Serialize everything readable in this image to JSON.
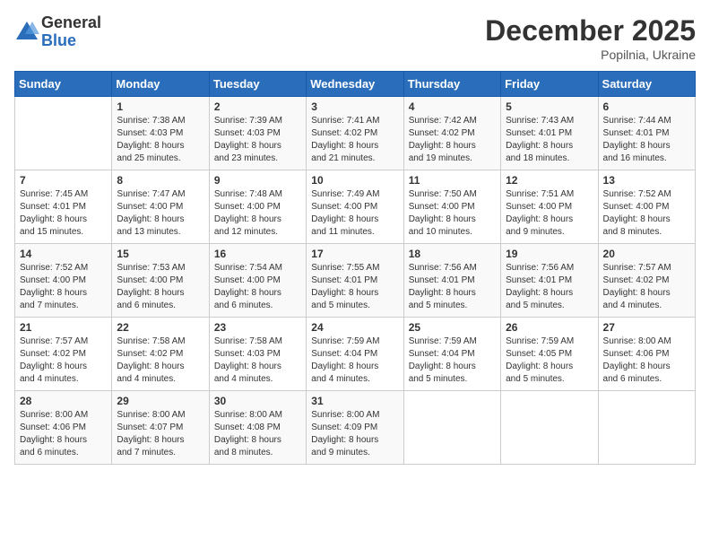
{
  "header": {
    "logo_general": "General",
    "logo_blue": "Blue",
    "month_year": "December 2025",
    "location": "Popilnia, Ukraine"
  },
  "days_of_week": [
    "Sunday",
    "Monday",
    "Tuesday",
    "Wednesday",
    "Thursday",
    "Friday",
    "Saturday"
  ],
  "weeks": [
    [
      {
        "day": "",
        "data": ""
      },
      {
        "day": "1",
        "data": "Sunrise: 7:38 AM\nSunset: 4:03 PM\nDaylight: 8 hours\nand 25 minutes."
      },
      {
        "day": "2",
        "data": "Sunrise: 7:39 AM\nSunset: 4:03 PM\nDaylight: 8 hours\nand 23 minutes."
      },
      {
        "day": "3",
        "data": "Sunrise: 7:41 AM\nSunset: 4:02 PM\nDaylight: 8 hours\nand 21 minutes."
      },
      {
        "day": "4",
        "data": "Sunrise: 7:42 AM\nSunset: 4:02 PM\nDaylight: 8 hours\nand 19 minutes."
      },
      {
        "day": "5",
        "data": "Sunrise: 7:43 AM\nSunset: 4:01 PM\nDaylight: 8 hours\nand 18 minutes."
      },
      {
        "day": "6",
        "data": "Sunrise: 7:44 AM\nSunset: 4:01 PM\nDaylight: 8 hours\nand 16 minutes."
      }
    ],
    [
      {
        "day": "7",
        "data": "Sunrise: 7:45 AM\nSunset: 4:01 PM\nDaylight: 8 hours\nand 15 minutes."
      },
      {
        "day": "8",
        "data": "Sunrise: 7:47 AM\nSunset: 4:00 PM\nDaylight: 8 hours\nand 13 minutes."
      },
      {
        "day": "9",
        "data": "Sunrise: 7:48 AM\nSunset: 4:00 PM\nDaylight: 8 hours\nand 12 minutes."
      },
      {
        "day": "10",
        "data": "Sunrise: 7:49 AM\nSunset: 4:00 PM\nDaylight: 8 hours\nand 11 minutes."
      },
      {
        "day": "11",
        "data": "Sunrise: 7:50 AM\nSunset: 4:00 PM\nDaylight: 8 hours\nand 10 minutes."
      },
      {
        "day": "12",
        "data": "Sunrise: 7:51 AM\nSunset: 4:00 PM\nDaylight: 8 hours\nand 9 minutes."
      },
      {
        "day": "13",
        "data": "Sunrise: 7:52 AM\nSunset: 4:00 PM\nDaylight: 8 hours\nand 8 minutes."
      }
    ],
    [
      {
        "day": "14",
        "data": "Sunrise: 7:52 AM\nSunset: 4:00 PM\nDaylight: 8 hours\nand 7 minutes."
      },
      {
        "day": "15",
        "data": "Sunrise: 7:53 AM\nSunset: 4:00 PM\nDaylight: 8 hours\nand 6 minutes."
      },
      {
        "day": "16",
        "data": "Sunrise: 7:54 AM\nSunset: 4:00 PM\nDaylight: 8 hours\nand 6 minutes."
      },
      {
        "day": "17",
        "data": "Sunrise: 7:55 AM\nSunset: 4:01 PM\nDaylight: 8 hours\nand 5 minutes."
      },
      {
        "day": "18",
        "data": "Sunrise: 7:56 AM\nSunset: 4:01 PM\nDaylight: 8 hours\nand 5 minutes."
      },
      {
        "day": "19",
        "data": "Sunrise: 7:56 AM\nSunset: 4:01 PM\nDaylight: 8 hours\nand 5 minutes."
      },
      {
        "day": "20",
        "data": "Sunrise: 7:57 AM\nSunset: 4:02 PM\nDaylight: 8 hours\nand 4 minutes."
      }
    ],
    [
      {
        "day": "21",
        "data": "Sunrise: 7:57 AM\nSunset: 4:02 PM\nDaylight: 8 hours\nand 4 minutes."
      },
      {
        "day": "22",
        "data": "Sunrise: 7:58 AM\nSunset: 4:02 PM\nDaylight: 8 hours\nand 4 minutes."
      },
      {
        "day": "23",
        "data": "Sunrise: 7:58 AM\nSunset: 4:03 PM\nDaylight: 8 hours\nand 4 minutes."
      },
      {
        "day": "24",
        "data": "Sunrise: 7:59 AM\nSunset: 4:04 PM\nDaylight: 8 hours\nand 4 minutes."
      },
      {
        "day": "25",
        "data": "Sunrise: 7:59 AM\nSunset: 4:04 PM\nDaylight: 8 hours\nand 5 minutes."
      },
      {
        "day": "26",
        "data": "Sunrise: 7:59 AM\nSunset: 4:05 PM\nDaylight: 8 hours\nand 5 minutes."
      },
      {
        "day": "27",
        "data": "Sunrise: 8:00 AM\nSunset: 4:06 PM\nDaylight: 8 hours\nand 6 minutes."
      }
    ],
    [
      {
        "day": "28",
        "data": "Sunrise: 8:00 AM\nSunset: 4:06 PM\nDaylight: 8 hours\nand 6 minutes."
      },
      {
        "day": "29",
        "data": "Sunrise: 8:00 AM\nSunset: 4:07 PM\nDaylight: 8 hours\nand 7 minutes."
      },
      {
        "day": "30",
        "data": "Sunrise: 8:00 AM\nSunset: 4:08 PM\nDaylight: 8 hours\nand 8 minutes."
      },
      {
        "day": "31",
        "data": "Sunrise: 8:00 AM\nSunset: 4:09 PM\nDaylight: 8 hours\nand 9 minutes."
      },
      {
        "day": "",
        "data": ""
      },
      {
        "day": "",
        "data": ""
      },
      {
        "day": "",
        "data": ""
      }
    ]
  ]
}
